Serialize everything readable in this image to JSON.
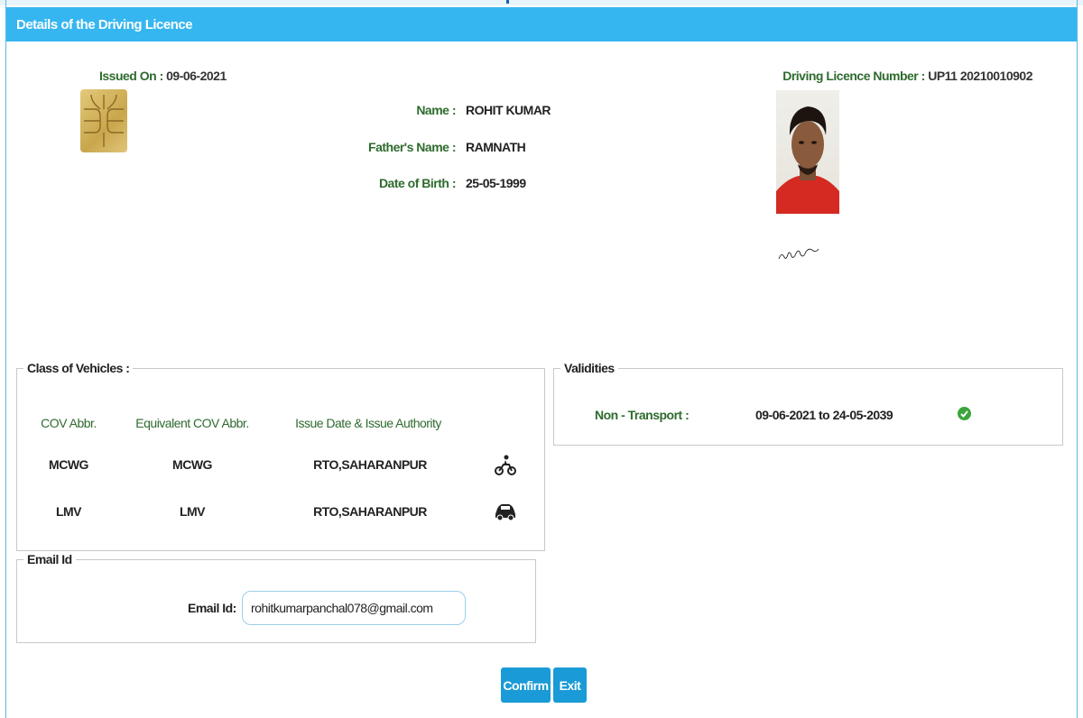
{
  "header": {
    "title": "Details of the Driving Licence"
  },
  "licence": {
    "issued_on_label": "Issued On :",
    "issued_on": "09-06-2021",
    "number_label": "Driving Licence Number :",
    "number": "UP11 20210010902",
    "name_label": "Name :",
    "name": "ROHIT KUMAR",
    "father_label": "Father's Name :",
    "father": "RAMNATH",
    "dob_label": "Date of Birth :",
    "dob": "25-05-1999"
  },
  "cov": {
    "legend": "Class of Vehicles :",
    "columns": [
      "COV Abbr.",
      "Equivalent COV Abbr.",
      "Issue Date & Issue Authority"
    ],
    "rows": [
      {
        "cov": "MCWG",
        "equiv": "MCWG",
        "authority": "RTO,SAHARANPUR",
        "icon": "motorcycle-icon"
      },
      {
        "cov": "LMV",
        "equiv": "LMV",
        "authority": "RTO,SAHARANPUR",
        "icon": "car-icon"
      }
    ]
  },
  "validities": {
    "legend": "Validities",
    "type_label": "Non - Transport :",
    "range": "09-06-2021 to 24-05-2039",
    "status_icon": "check-circle-icon",
    "status_color": "#3aa63a"
  },
  "email": {
    "legend": "Email Id",
    "label": "Email Id:",
    "value": "rohitkumarpanchal078@gmail.com"
  },
  "buttons": {
    "confirm": "Confirm",
    "exit": "Exit"
  },
  "colors": {
    "header": "#36b6f0",
    "button": "#1a9ad6",
    "label_green": "#2e6b2e"
  }
}
